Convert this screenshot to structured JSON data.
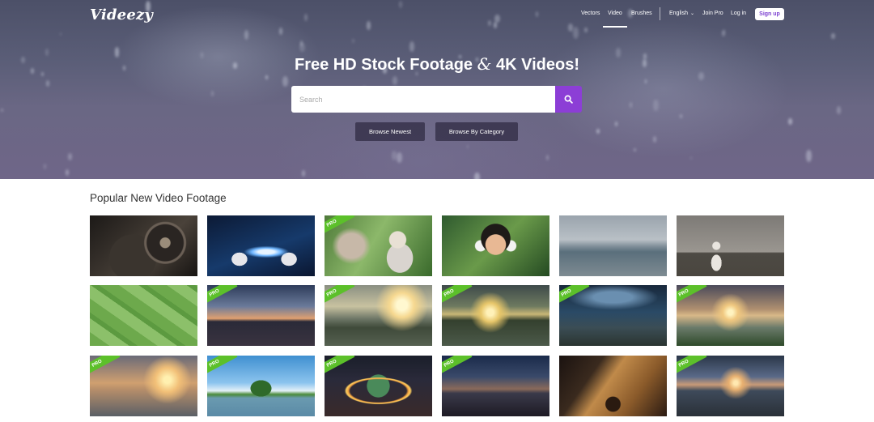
{
  "brand": {
    "logo_text": "Videezy"
  },
  "nav": {
    "vectors": "Vectors",
    "video": "Video",
    "brushes": "Brushes",
    "language": "English",
    "join_pro": "Join Pro",
    "log_in": "Log in",
    "sign_up": "Sign up"
  },
  "hero": {
    "title_part1": "Free HD Stock Footage ",
    "title_amp": "&",
    "title_part2": " 4K Videos!",
    "search_placeholder": "Search",
    "browse_newest": "Browse Newest",
    "browse_category": "Browse By Category"
  },
  "section": {
    "title": "Popular New Video Footage"
  },
  "pro_label": "PRO",
  "thumbnails": [
    {
      "pro": false,
      "scene": "vinyl-turntable-closeup"
    },
    {
      "pro": false,
      "scene": "hands-holding-glowing-tablet"
    },
    {
      "pro": true,
      "scene": "elderly-person-in-garden"
    },
    {
      "pro": false,
      "scene": "girl-with-headphones"
    },
    {
      "pro": false,
      "scene": "coastal-city-bay"
    },
    {
      "pro": false,
      "scene": "boy-with-toy-airplane"
    },
    {
      "pro": false,
      "scene": "aerial-green-fields"
    },
    {
      "pro": true,
      "scene": "city-skyline-dusk"
    },
    {
      "pro": true,
      "scene": "sunset-over-mangroves"
    },
    {
      "pro": true,
      "scene": "river-sunset-clouds"
    },
    {
      "pro": true,
      "scene": "night-sky-over-boats"
    },
    {
      "pro": true,
      "scene": "sunrise-over-misty-hills"
    },
    {
      "pro": true,
      "scene": "old-pier-at-sunset"
    },
    {
      "pro": true,
      "scene": "tree-in-lake-blue-sky"
    },
    {
      "pro": true,
      "scene": "traffic-roundabout-night"
    },
    {
      "pro": true,
      "scene": "city-skyline-night"
    },
    {
      "pro": false,
      "scene": "guitar-playing-closeup"
    },
    {
      "pro": true,
      "scene": "misty-mountain-sunrise"
    }
  ]
}
